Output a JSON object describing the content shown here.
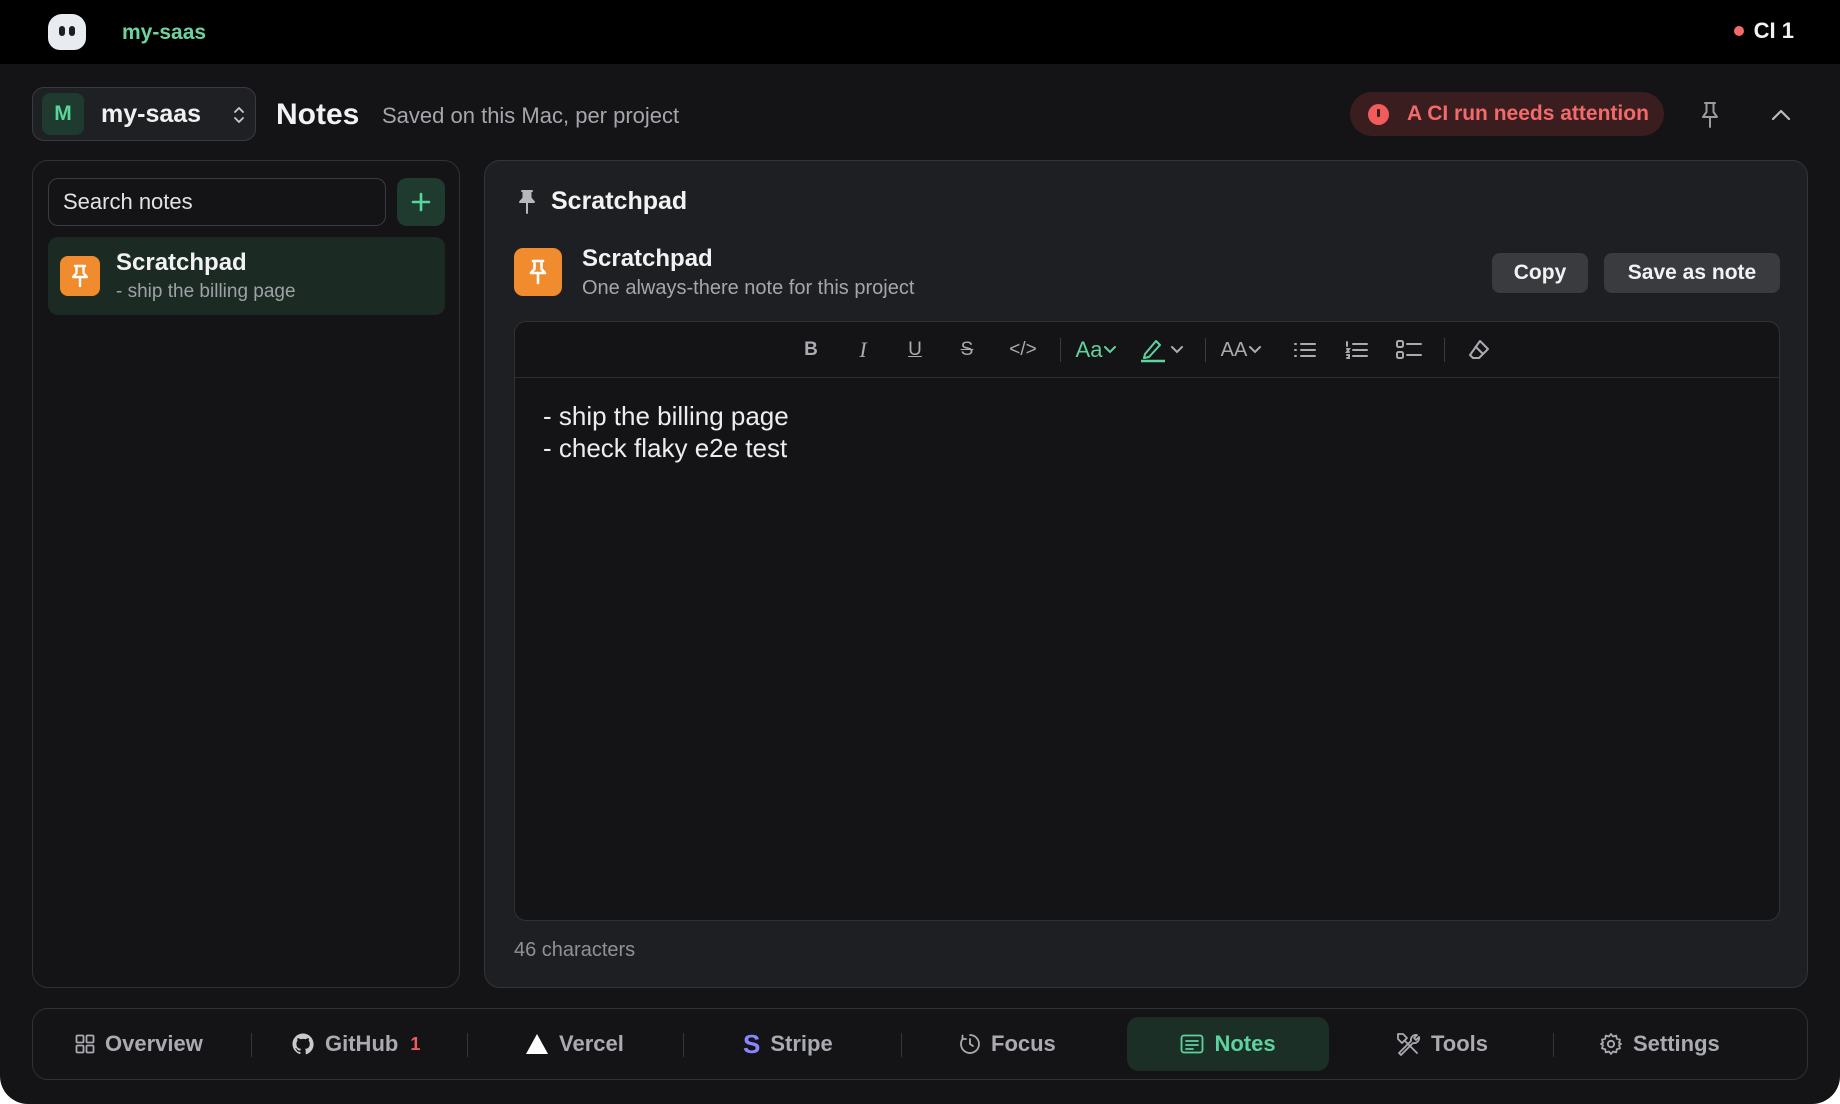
{
  "topbar": {
    "project": "my-saas",
    "ci_label": "CI 1",
    "colors": {
      "accent": "#6fd3a1",
      "ci_dot": "#f26a6a"
    }
  },
  "header": {
    "picker": {
      "avatar_letter": "M",
      "name": "my-saas"
    },
    "title": "Notes",
    "subtitle": "Saved on this Mac, per project",
    "alert": "A CI run needs attention",
    "icons": [
      "pin-icon",
      "chevron-up-icon"
    ]
  },
  "sidebar": {
    "search_placeholder": "Search notes",
    "add_icon": "plus-icon",
    "notes": [
      {
        "title": "Scratchpad",
        "preview": "- ship the billing page",
        "icon": "pin-icon"
      }
    ]
  },
  "panel": {
    "header_title": "Scratchpad",
    "scratchpad": {
      "title": "Scratchpad",
      "description": "One always-there note for this project"
    },
    "buttons": {
      "copy": "Copy",
      "save": "Save as note"
    },
    "toolbar": {
      "bold": "B",
      "italic": "I",
      "underline": "U",
      "strike": "S",
      "code": "</>",
      "font": "Aa",
      "size": "AA"
    },
    "content": "- ship the billing page\n- check flaky e2e test",
    "char_count": "46 characters"
  },
  "bottom_nav": {
    "items": [
      {
        "label": "Overview",
        "icon": "grid-icon"
      },
      {
        "label": "GitHub",
        "icon": "github-icon",
        "count": "1"
      },
      {
        "label": "Vercel",
        "icon": "triangle-icon"
      },
      {
        "label": "Stripe",
        "icon": "stripe-icon"
      },
      {
        "label": "Focus",
        "icon": "timer-icon"
      },
      {
        "label": "Notes",
        "icon": "notes-icon",
        "active": true
      },
      {
        "label": "Tools",
        "icon": "tools-icon"
      },
      {
        "label": "Settings",
        "icon": "gear-icon"
      }
    ],
    "colors": {
      "active_text": "#5fd39e",
      "active_bg": "#1c2f27",
      "badge": "#f25b5b"
    }
  }
}
